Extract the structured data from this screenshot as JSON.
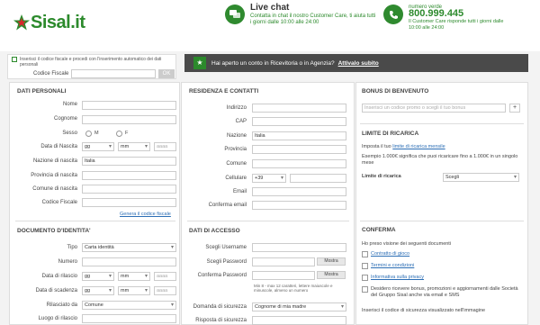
{
  "header": {
    "logo_text": "Sisal",
    "logo_tld": ".it",
    "chat_title": "Live chat",
    "chat_text": "Contatta in chat il nostro Customer Care, ti aiuta tutti i giorni dalle 10:00 alle 24:00",
    "phone_label": "numero verde",
    "phone_number": "800.999.445",
    "phone_text": "Il Customer Care risponde tutti i giorni dalle 10:00 alle 24:00"
  },
  "codice_fiscale": {
    "info": "Inserisci il codice fiscale e procedi con l'inserimento automatico dei dati personali",
    "label": "Codice Fiscale",
    "button": "OK"
  },
  "banner": {
    "text": "Hai aperto un conto in Ricevitoria o in Agenzia?",
    "link": "Attivalo subito"
  },
  "dati_personali": {
    "title": "DATI PERSONALI",
    "nome": "Nome",
    "cognome": "Cognome",
    "sesso": "Sesso",
    "sesso_m": "M",
    "sesso_f": "F",
    "data_nascita": "Data di Nascita",
    "gg": "gg",
    "mm": "mm",
    "aaaa": "aaaa",
    "nazione_nascita": "Nazione di nascita",
    "nazione_value": "Italia",
    "provincia_nascita": "Provincia di nascita",
    "comune_nascita": "Comune di nascita",
    "codice_fiscale": "Codice Fiscale",
    "genera_link": "Genera il codice fiscale"
  },
  "documento": {
    "title": "DOCUMENTO D'IDENTITA'",
    "tipo": "Tipo",
    "tipo_value": "Carta identità",
    "numero": "Numero",
    "data_rilascio": "Data di rilascio",
    "data_scadenza": "Data di scadenza",
    "rilasciato_da": "Rilasciato da",
    "rilasciato_value": "Comune",
    "luogo_rilascio": "Luogo di rilascio"
  },
  "residenza": {
    "title": "RESIDENZA E CONTATTI",
    "indirizzo": "Indirizzo",
    "cap": "CAP",
    "nazione": "Nazione",
    "nazione_value": "Italia",
    "provincia": "Provincia",
    "comune": "Comune",
    "cellulare": "Cellulare",
    "prefisso": "+39",
    "email": "Email",
    "conferma_email": "Conferma email"
  },
  "accesso": {
    "title": "DATI DI ACCESSO",
    "username": "Scegli Username",
    "password": "Scegli Password",
    "conferma_password": "Conferma Password",
    "mostra": "Mostra",
    "hint": "Min 8 - max 12 caratteri, lettere maiuscole e minuscole, almeno un numero",
    "domanda": "Domanda di sicurezza",
    "domanda_value": "Cognome di mia madre",
    "risposta": "Risposta di sicurezza"
  },
  "bonus": {
    "title": "BONUS DI BENVENUTO",
    "placeholder": "Inserisci un codice promo o scegli il tuo bonus",
    "plus": "+"
  },
  "limite": {
    "title": "LIMITE DI RICARICA",
    "imposta": "Imposta il tuo",
    "imposta_link": "limite di ricarica mensile",
    "esempio": "Esempio 1.000€ significa che puoi ricaricare fino a 1.000€ in un singolo mese",
    "label": "Limite di ricarica",
    "select": "Scegli"
  },
  "conferma": {
    "title": "CONFERMA",
    "presa": "Ho preso visione dei seguenti documenti",
    "contratto": "Contratto di gioco",
    "termini": "Termini e condizioni",
    "privacy": "Informativa sulla privacy",
    "desidero": "Desidero ricevere bonus, promozioni e aggiornamenti dalle Società del Gruppo Sisal anche via email e SMS",
    "inserisci": "Inserisci il codice di sicurezza visualizzato nell'immagine"
  },
  "colors": {
    "brand_green": "#2c8a2c",
    "banner_bg": "#4a4a4a",
    "link_blue": "#2c6eb5"
  }
}
